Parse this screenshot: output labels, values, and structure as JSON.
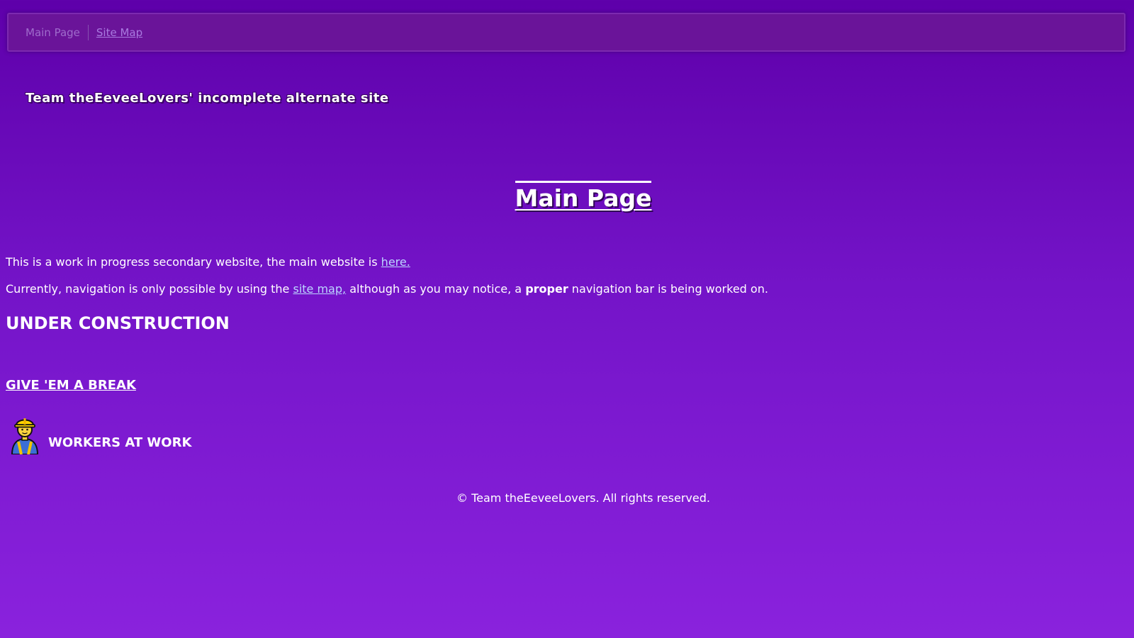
{
  "nav": {
    "main_page": "Main Page",
    "site_map": "Site Map"
  },
  "site_title": "Team theEeveeLovers' incomplete alternate site",
  "heading": "Main Page",
  "intro": {
    "p1_text": "This is a work in progress secondary website, the main website is ",
    "p1_link": "here.",
    "p2_before": "Currently, navigation is only possible by using the ",
    "p2_link": "site map,",
    "p2_middle": " although as you may notice, a ",
    "p2_bold": "proper",
    "p2_after": " navigation bar is being worked on."
  },
  "under_construction": "UNDER CONSTRUCTION",
  "break_link": "GIVE 'EM A BREAK",
  "workers": {
    "icon": "construction-worker-icon",
    "label": "WORKERS AT WORK"
  },
  "footer": "© Team theEeveeLovers. All rights reserved.",
  "colors": {
    "background_top": "#5e00aa",
    "background_bottom": "#8a22dd",
    "link": "#bcd6ff"
  }
}
